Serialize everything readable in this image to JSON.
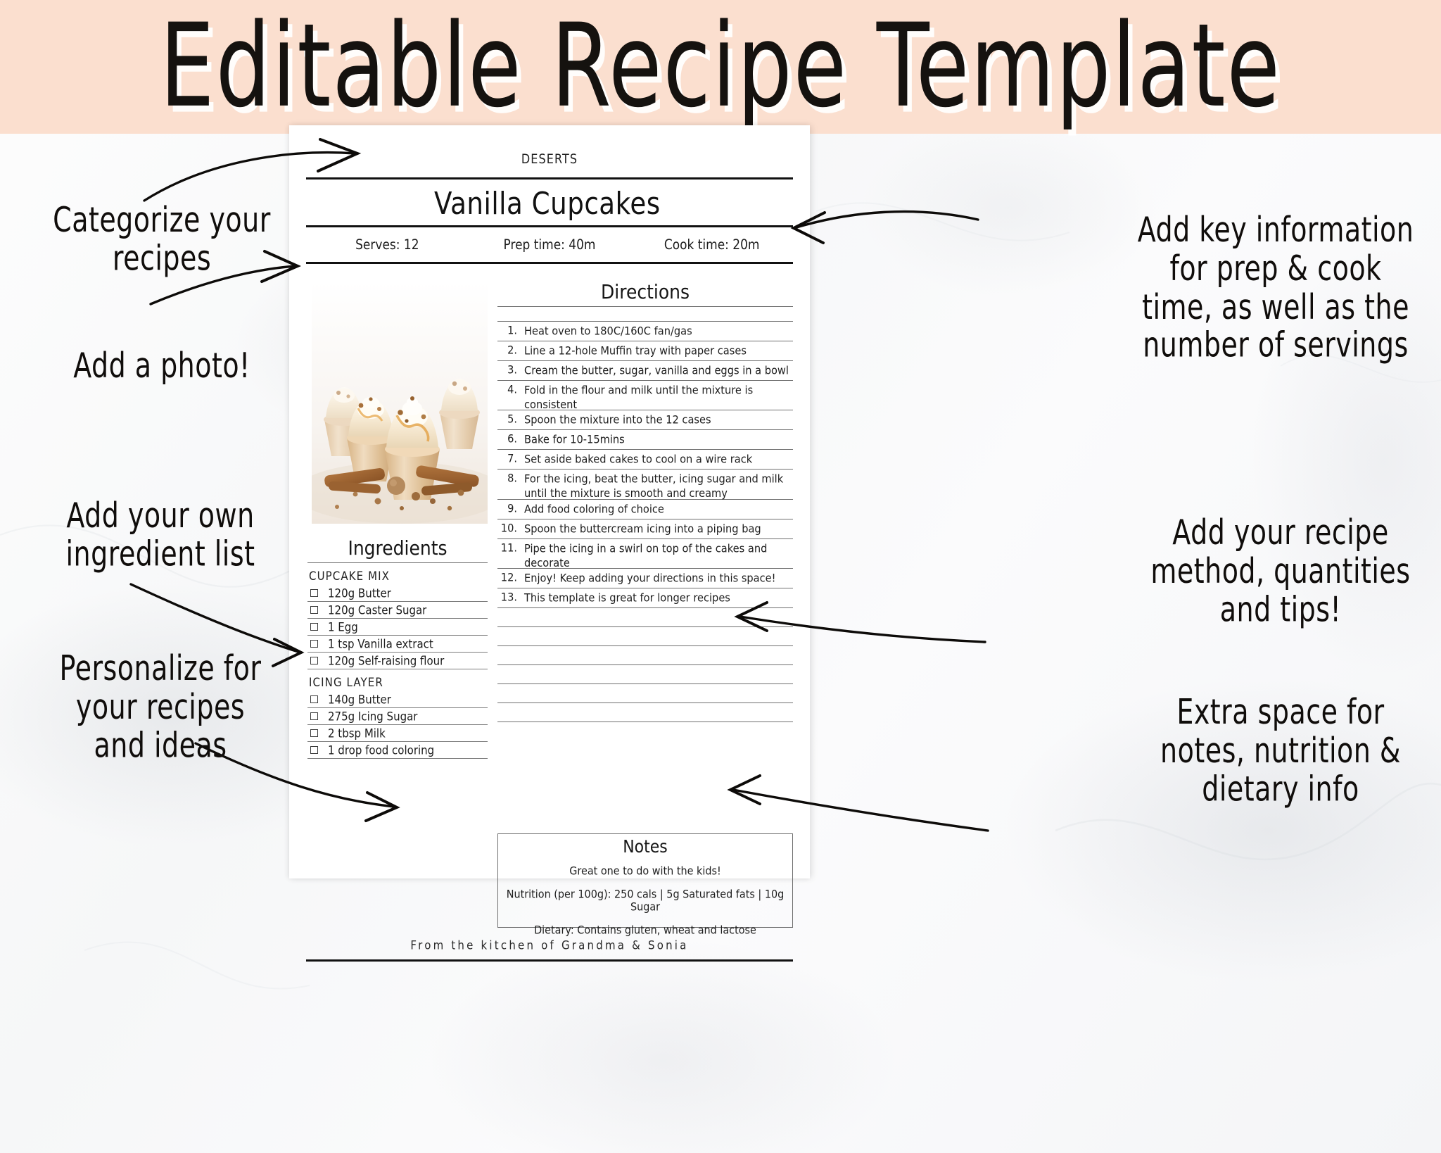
{
  "banner": {
    "title": "Editable Recipe Template",
    "bg_color": "#fbdfcf",
    "text_color": "#15120f"
  },
  "recipe": {
    "category": "DESERTS",
    "name": "Vanilla Cupcakes",
    "meta": [
      {
        "key": "serves",
        "label": "Serves: 12"
      },
      {
        "key": "prep_time",
        "label": "Prep time: 40m"
      },
      {
        "key": "cook_time",
        "label": "Cook time: 20m"
      }
    ],
    "photo_alt": "vanilla cupcakes with buttercream swirl, caramel drizzle, cinnamon sticks and nutmeg",
    "directions_heading": "Directions",
    "directions": [
      "Heat oven to 180C/160C fan/gas",
      "Line a 12-hole Muffin tray with paper cases",
      "Cream the butter, sugar, vanilla and eggs in a  bowl",
      "Fold in the flour and milk until the mixture is consistent",
      "Spoon the mixture into the 12 cases",
      "Bake for 10-15mins",
      "Set aside baked cakes to cool on a wire rack",
      "For the icing, beat the butter, icing sugar and milk until the mixture is smooth and creamy",
      "Add food coloring of choice",
      "Spoon the buttercream icing into a piping bag",
      "Pipe the icing in a swirl on top of the cakes and decorate",
      "Enjoy! Keep adding your directions in this space!",
      "This template is great for longer recipes"
    ],
    "blank_direction_rows": 7,
    "ingredients_heading": "Ingredients",
    "ingredient_groups": [
      {
        "label": "CUPCAKE MIX",
        "items": [
          "120g Butter",
          "120g Caster Sugar",
          "1 Egg",
          "1 tsp Vanilla extract",
          "120g Self-raising flour"
        ]
      },
      {
        "label": "ICING LAYER",
        "items": [
          "140g Butter",
          "275g Icing Sugar",
          "2 tbsp Milk",
          "1 drop food coloring"
        ]
      }
    ],
    "notes": {
      "title": "Notes",
      "line1": "Great one to do with the kids!",
      "line2": "Nutrition (per 100g):  250 cals | 5g Saturated fats | 10g Sugar",
      "line3": "Dietary: Contains gluten, wheat and lactose"
    },
    "footer": "From the kitchen of Grandma & Sonia"
  },
  "annotations": {
    "left": [
      {
        "key": "categorize",
        "text": "Categorize your\nrecipes"
      },
      {
        "key": "photo",
        "text": "Add a photo!"
      },
      {
        "key": "ingredients",
        "text": "Add your own\ningredient list"
      },
      {
        "key": "personalize",
        "text": "Personalize for\nyour recipes\nand ideas"
      }
    ],
    "right": [
      {
        "key": "key-info",
        "text": "Add key information\nfor prep & cook\ntime, as well as the\nnumber of servings"
      },
      {
        "key": "method",
        "text": "Add your recipe\nmethod, quantities\nand tips!"
      },
      {
        "key": "extra-space",
        "text": "Extra space for\nnotes, nutrition &\ndietary info"
      }
    ]
  }
}
